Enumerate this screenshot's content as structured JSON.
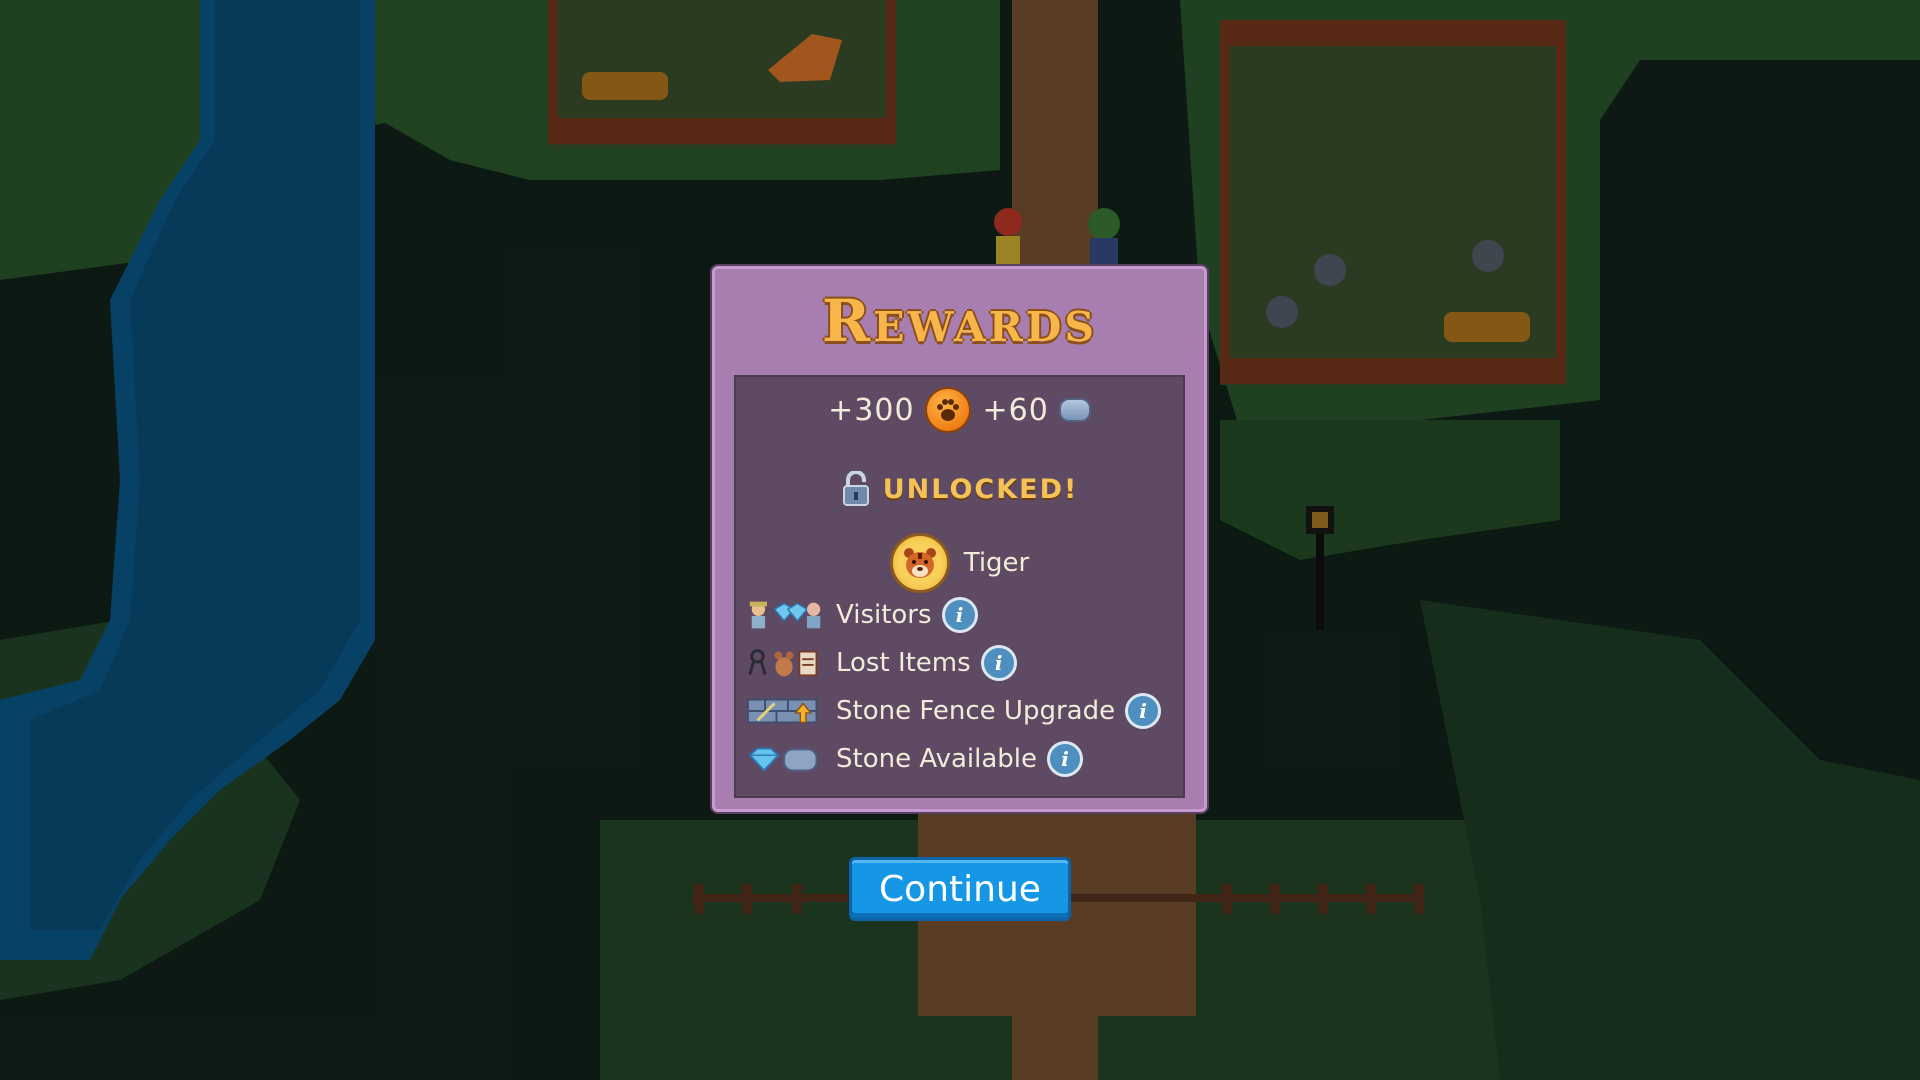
{
  "rewards": {
    "title": "Rewards",
    "paw_coins": "+300",
    "stones": "+60",
    "unlocked_label": "UNLOCKED!",
    "animal_name": "Tiger",
    "features": {
      "visitors": "Visitors",
      "lost_items": "Lost Items",
      "stone_fence": "Stone Fence Upgrade",
      "stone_available": "Stone Available"
    },
    "info_glyph": "i",
    "continue_label": "Continue"
  },
  "icons": {
    "paw_coin": "paw-coin-icon",
    "stone": "stone-icon",
    "lock": "open-lock-icon",
    "tiger": "tiger-icon",
    "info": "info-icon"
  },
  "colors": {
    "panel": "#a87eb0",
    "panel_inner": "#5e4a63",
    "title": "#f8b64a",
    "unlocked": "#f6c255",
    "button": "#1597e5"
  }
}
